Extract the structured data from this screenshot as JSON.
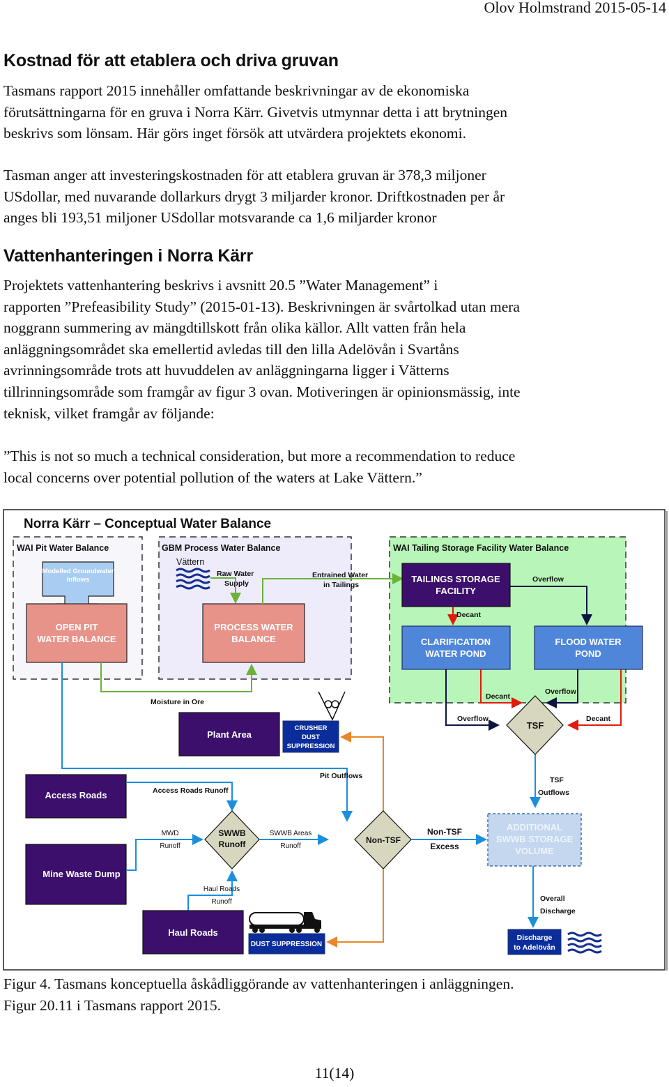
{
  "header": {
    "author_date": "Olov Holmstrand 2015-05-14"
  },
  "sections": [
    {
      "heading": "Kostnad för att etablera och driva gruvan",
      "paragraphs": [
        [
          "Tasmans rapport 2015 innehåller omfattande beskrivningar av de ekonomiska",
          "förutsättningarna för en gruva i Norra Kärr. Givetvis utmynnar detta i att brytningen",
          "beskrivs som lönsam. Här görs inget försök att utvärdera projektets ekonomi."
        ],
        [
          "Tasman anger att investeringskostnaden för att etablera gruvan är 378,3 miljoner",
          "USdollar, med nuvarande dollarkurs drygt 3 miljarder kronor. Driftkostnaden per år",
          "anges bli 193,51 miljoner USdollar motsvarande ca 1,6 miljarder kronor"
        ]
      ]
    },
    {
      "heading": "Vattenhanteringen i Norra Kärr",
      "paragraphs": [
        [
          "Projektets vattenhantering beskrivs i avsnitt 20.5 ”Water Management” i",
          "rapporten ”Prefeasibility Study” (2015-01-13). Beskrivningen är svårtolkad utan mera",
          "noggrann summering av mängdtillskott från olika källor. Allt vatten från hela",
          "anläggningsområdet ska emellertid avledas till den lilla Adelövån i Svartåns",
          "avrinningsområde trots att huvuddelen av anläggningarna ligger i Vätterns",
          "tillrinningsområde som framgår av figur 3 ovan. Motiveringen är opinionsmässig, inte",
          "teknisk, vilket framgår av följande:"
        ],
        [
          "”This is not so much a technical consideration, but more a recommendation to reduce",
          "local concerns over potential pollution of the waters at Lake Vättern.”"
        ]
      ]
    }
  ],
  "figure": {
    "title": "Norra Kärr – Conceptual Water Balance",
    "sections": {
      "pit": "WAI Pit Water Balance",
      "process": "GBM Process Water Balance",
      "tsf": "WAI Tailing Storage Facility Water Balance"
    },
    "boxes": {
      "groundwater": [
        "Modelled Groundwater",
        "Inflows"
      ],
      "open_pit": [
        "OPEN PIT",
        "WATER BALANCE"
      ],
      "process": [
        "PROCESS WATER",
        "BALANCE"
      ],
      "tailings": [
        "TAILINGS STORAGE",
        "FACILITY"
      ],
      "clarification": [
        "CLARIFICATION",
        "WATER POND"
      ],
      "flood": [
        "FLOOD WATER",
        "POND"
      ],
      "plant": "Plant Area",
      "crusher": [
        "CRUSHER",
        "DUST",
        "SUPPRESSION"
      ],
      "access": "Access Roads",
      "mine_waste": "Mine Waste Dump",
      "haul": "Haul Roads",
      "dust": "DUST SUPPRESSION",
      "additional": [
        "ADDITIONAL",
        "SWWB STORAGE",
        "VOLUME"
      ],
      "discharge": [
        "Discharge",
        "to Adelövån"
      ]
    },
    "nodes": {
      "tsf": "TSF",
      "swwb": [
        "SWWB",
        "Runoff"
      ],
      "nontsf": "Non-TSF"
    },
    "labels": {
      "vattern": "Vättern",
      "raw_water": [
        "Raw Water",
        "Supply"
      ],
      "entrained": [
        "Entrained Water",
        "in Tailings"
      ],
      "overflow_tsf": "Overflow",
      "decant_tsf": "Decant",
      "decant_left": "Decant",
      "overflow_right": "Overflow",
      "overflow_left": "Overflow",
      "decant_right": "Decant",
      "moisture": "Moisture in Ore",
      "pit_outflows": "Pit Outflows",
      "access_runoff": "Access Roads Runoff",
      "mwd_runoff": [
        "MWD",
        "Runoff"
      ],
      "swwb_areas": [
        "SWWB Areas",
        "Runoff"
      ],
      "nontsf_excess": [
        "Non-TSF",
        "Excess"
      ],
      "tsf_outflows": [
        "TSF",
        "Outflows"
      ],
      "haul_runoff": [
        "Haul Roads",
        "Runoff"
      ],
      "overall": [
        "Overall",
        "Discharge"
      ]
    },
    "colors": {
      "purple_box": "#3b0f6b",
      "salmon_box": "#e8938a",
      "pond_blue": "#4f86d9",
      "navy_box": "#0b2d9c",
      "diamond": "#d6d7be",
      "tsf_bg": "#b8f5b8",
      "process_bg": "#eeecfb",
      "pit_bg": "#f7f7fb",
      "green_line": "#6ab23a",
      "blue_line": "#1b8fdc",
      "orange_line": "#e8862a",
      "red_line": "#e01b0b"
    }
  },
  "caption": [
    "Figur 4. Tasmans konceptuella åskådliggörande av vattenhanteringen i anläggningen.",
    "Figur 20.11 i Tasmans rapport 2015."
  ],
  "page_number": "11(14)"
}
